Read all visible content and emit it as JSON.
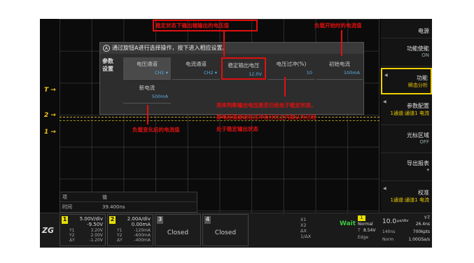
{
  "annotations": {
    "top_center": "稳定状态下输出端输出的电压值",
    "top_right": "负载开始时的电流值",
    "right_mid_line1": "用来判断输出电压是否已经处于稳定状态，",
    "right_mid_line2": "即电压值波动在过冲百分比之内就认为已经",
    "right_mid_line3": "处于稳定输出状态",
    "bottom_left": "负载变化后的电流值"
  },
  "markers": {
    "trigger": "T",
    "ch2": "2",
    "ch1": "1"
  },
  "right_panel": {
    "title": "电源",
    "items": [
      {
        "label": "功能使能",
        "value": "ON"
      },
      {
        "label": "功能",
        "value": "瞬态分析"
      },
      {
        "label": "参数配置",
        "value": "1通道:通道1 电流"
      },
      {
        "label": "光标区域",
        "value": "OFF"
      },
      {
        "label": "导出报表",
        "value": ""
      },
      {
        "label": "校准",
        "value": "1通道:通道1 电流"
      }
    ]
  },
  "dialog": {
    "header": "通过旋钮A进行选择操作，按下进入相应设置。",
    "category_line1": "参数",
    "category_line2": "设置",
    "cells": [
      {
        "name": "电压通道",
        "value": "CH1"
      },
      {
        "name": "电流通道",
        "value": "CH2"
      },
      {
        "name": "稳定输出电压",
        "value": "12.0V"
      },
      {
        "name": "电压过冲(%)",
        "value": "10"
      },
      {
        "name": "初始电流",
        "value": "100mA"
      },
      {
        "name": "新电流",
        "value": "500mA"
      }
    ]
  },
  "meas_table": {
    "headers": [
      "项",
      "值"
    ],
    "row_label": "时间",
    "row_value": "39.400ns"
  },
  "bottom": {
    "logo": "ZG",
    "ch1": {
      "num": "1",
      "vdiv": "5.00V/div",
      "offset": "-9.50V",
      "y1": "3.20V",
      "y2": "2.00V",
      "dy": "-1.20V",
      "y1_label": "Y1",
      "y2_label": "Y2",
      "dy_label": "ΔY"
    },
    "ch2": {
      "num": "2",
      "vdiv": "2.00A/div",
      "offset": "0.00mA",
      "y1": "-120mA",
      "y2": "-600mA",
      "dy": "-400mA",
      "y1_label": "Y1",
      "y2_label": "Y2",
      "dy_label": "ΔY"
    },
    "ch3": {
      "num": "3",
      "status": "Closed"
    },
    "ch4": {
      "num": "4",
      "status": "Closed"
    },
    "cursor": {
      "x1": "X1",
      "x2": "X2",
      "dx": "ΔX",
      "inv": "1/ΔX"
    },
    "trigger": {
      "state": "Wait",
      "mode": "Normal",
      "t_label": "T",
      "t_val": "8.54V",
      "edge": "Edge",
      "source": "1"
    },
    "timebase": {
      "tdiv": "10.0",
      "unit": "μs/div",
      "samples": "140ns",
      "mode": "Norm",
      "yt": "Y-T",
      "srate": "26.4ns",
      "pts": "700kpts",
      "rate": "1.00GSa/s"
    }
  }
}
